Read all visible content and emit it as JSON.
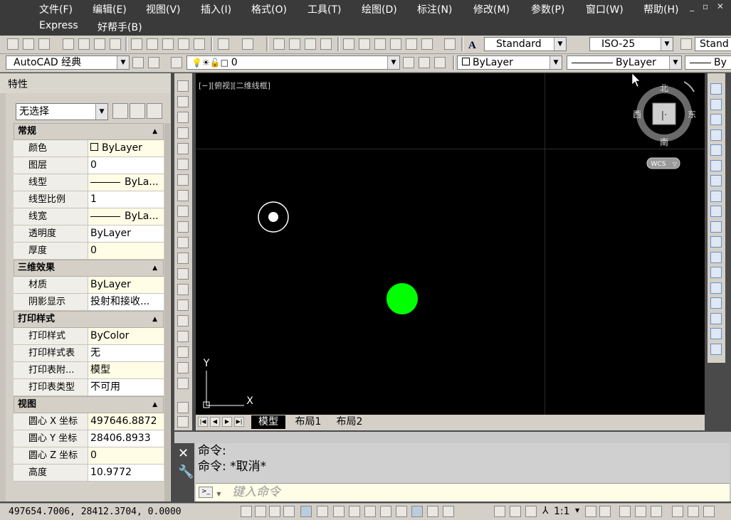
{
  "menu": {
    "items": [
      "文件(F)",
      "编辑(E)",
      "视图(V)",
      "插入(I)",
      "格式(O)",
      "工具(T)",
      "绘图(D)",
      "标注(N)",
      "修改(M)",
      "参数(P)",
      "窗口(W)",
      "帮助(H)"
    ],
    "row2": [
      "Express",
      "好帮手(B)"
    ]
  },
  "toolbar1": {
    "text_style": "Standard",
    "dim_style": "ISO-25",
    "table_style_partial": "Stand"
  },
  "toolbar2": {
    "workspace": "AutoCAD 经典",
    "layer": "0",
    "color": "ByLayer",
    "linetype": "ByLayer",
    "lineweight_partial": "By"
  },
  "properties": {
    "title": "特性",
    "selection": "无选择",
    "sections": [
      {
        "name": "常规",
        "rows": [
          {
            "k": "颜色",
            "v": "ByLayer",
            "swatch": true
          },
          {
            "k": "图层",
            "v": "0"
          },
          {
            "k": "线型",
            "v": "ByLa...",
            "line": true
          },
          {
            "k": "线型比例",
            "v": "1"
          },
          {
            "k": "线宽",
            "v": "ByLa...",
            "line": true
          },
          {
            "k": "透明度",
            "v": "ByLayer"
          },
          {
            "k": "厚度",
            "v": "0"
          }
        ]
      },
      {
        "name": "三维效果",
        "rows": [
          {
            "k": "材质",
            "v": "ByLayer"
          },
          {
            "k": "阴影显示",
            "v": "投射和接收..."
          }
        ]
      },
      {
        "name": "打印样式",
        "rows": [
          {
            "k": "打印样式",
            "v": "ByColor"
          },
          {
            "k": "打印样式表",
            "v": "无"
          },
          {
            "k": "打印表附...",
            "v": "模型"
          },
          {
            "k": "打印表类型",
            "v": "不可用"
          }
        ]
      },
      {
        "name": "视图",
        "rows": [
          {
            "k": "圆心 X 坐标",
            "v": "497646.8872"
          },
          {
            "k": "圆心 Y 坐标",
            "v": "28406.8933"
          },
          {
            "k": "圆心 Z 坐标",
            "v": "0"
          },
          {
            "k": "高度",
            "v": "10.9772"
          }
        ]
      }
    ]
  },
  "viewport": {
    "label": "[−][俯视][二维线框]",
    "viewcube": {
      "north": "北",
      "south": "南",
      "east": "东",
      "west": "西",
      "wcs": "WCS"
    },
    "ucs": {
      "x": "X",
      "y": "Y"
    },
    "colors": {
      "background": "#000000",
      "ring": "#ffffff",
      "filled_circle": "#00ff00"
    }
  },
  "layout_tabs": [
    "模型",
    "布局1",
    "布局2"
  ],
  "command": {
    "history": [
      "命令:",
      "命令: *取消*"
    ],
    "placeholder": "键入命令"
  },
  "status": {
    "coords": "497654.7006, 28412.3704, 0.0000",
    "scale": "1:1"
  }
}
